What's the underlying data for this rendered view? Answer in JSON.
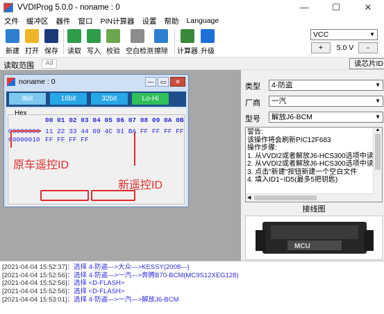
{
  "window": {
    "title": "VVDIProg 5.0.0 - noname : 0",
    "minimize": "—",
    "maximize": "☐",
    "close": "✕"
  },
  "menu": [
    "文件",
    "缓冲区",
    "器件",
    "窗口",
    "PIN计算器",
    "设置",
    "帮助",
    "Language"
  ],
  "toolbar": {
    "items": [
      {
        "label": "新建",
        "icon": "new-file-icon",
        "color": "#2f7fd1"
      },
      {
        "label": "打开",
        "icon": "open-folder-icon",
        "color": "#f0b429"
      },
      {
        "label": "保存",
        "icon": "save-disk-icon",
        "color": "#1b3a7a"
      },
      {
        "label": "读取",
        "icon": "read-chip-icon",
        "color": "#2f9c4a"
      },
      {
        "label": "写入",
        "icon": "write-chip-icon",
        "color": "#2f9c4a"
      },
      {
        "label": "校验",
        "icon": "verify-icon",
        "color": "#6aa84f"
      },
      {
        "label": "空白检测",
        "icon": "blank-check-icon",
        "color": "#8c8c8c"
      },
      {
        "label": "擦除",
        "icon": "erase-icon",
        "color": "#2f7fd1"
      },
      {
        "label": "计算器",
        "icon": "calculator-icon",
        "color": "#3b8a3b"
      },
      {
        "label": "升级",
        "icon": "upgrade-icon",
        "color": "#1e6fd9"
      }
    ],
    "vcc": "VCC",
    "plus": "+",
    "voltage": "5.0 V",
    "minus": "-"
  },
  "range": {
    "label": "读取范围",
    "value": "All",
    "read_id_button": "读芯片ID"
  },
  "child": {
    "title": "noname : 0",
    "tabs": [
      "8bit",
      "16bit",
      "32bit",
      "Lo-Hi"
    ],
    "active_tab": "8bit",
    "hex_label": "Hex",
    "header": "00 01 02 03 04 05 06 07 08 09 0A 0B",
    "addresses": [
      "00000000",
      "00000010"
    ],
    "rows": [
      "11 22 33 44 09 4C 91 BA FF FF FF FF",
      "FF FF FF FF"
    ]
  },
  "annotations": {
    "original_id": "原车遥控ID",
    "new_id": "新遥控ID",
    "color": "#e12b2b"
  },
  "right": {
    "type_label": "类型",
    "type_value": "4-防盗",
    "maker_label": "厂商",
    "maker_value": "一汽",
    "model_label": "型号",
    "model_value": "解放J6-BCM",
    "info_lines": [
      "警告:",
      "该操作将会刷新PIC12F683",
      "操作步骤:",
      "1. 从VVDI2或者解放J6-HCS300选项中读",
      "2. 从VVDI2或者解放J6-HCS300选项中读",
      "3. 点击\"新建\"按钮新建一个空白文件",
      "4. 填入ID1~ID5(最多5把钥匙)"
    ],
    "wiring_label": "接线图",
    "connector_text": "MCU"
  },
  "log": [
    {
      "ts": "[2021-04-04 15:52:37]",
      "msg": "：选择 4-防盗—>大众—>KESSY(2008—)"
    },
    {
      "ts": "[2021-04-04 15:52:56]",
      "msg": "：选择 4-防盗—>一汽—>奔腾B70-BCM(MC9S12XEG128)"
    },
    {
      "ts": "[2021-04-04 15:52:56]",
      "msg": "：选择 <D-FLASH>"
    },
    {
      "ts": "[2021-04-04 15:52:56]",
      "msg": "：选择 <D-FLASH>"
    },
    {
      "ts": "[2021-04-04 15:53:01]",
      "msg": "：选择 4-防盗—>一汽—>解放J6-BCM"
    }
  ]
}
